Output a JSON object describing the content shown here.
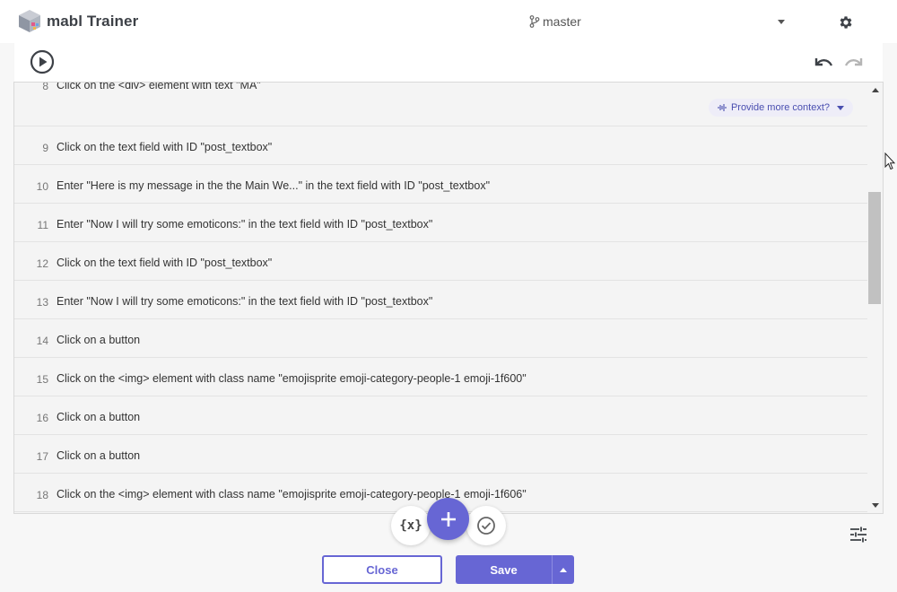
{
  "header": {
    "app_title": "mabl Trainer",
    "branch": "master"
  },
  "steps": [
    {
      "num": "8",
      "text": "Click on the <div> element with text \"MA\"",
      "context_label": "Provide more context?"
    },
    {
      "num": "9",
      "text": "Click on the text field with ID \"post_textbox\""
    },
    {
      "num": "10",
      "text": "Enter \"Here is my message in the the Main We...\" in the text field with ID \"post_textbox\""
    },
    {
      "num": "11",
      "text": "Enter \"Now I will try some emoticons:\" in the text field with ID \"post_textbox\""
    },
    {
      "num": "12",
      "text": "Click on the text field with ID \"post_textbox\""
    },
    {
      "num": "13",
      "text": "Enter \"Now I will try some emoticons:\" in the text field with ID \"post_textbox\""
    },
    {
      "num": "14",
      "text": "Click on a button"
    },
    {
      "num": "15",
      "text": "Click on the <img> element with class name \"emojisprite emoji-category-people-1 emoji-1f600\""
    },
    {
      "num": "16",
      "text": "Click on a button"
    },
    {
      "num": "17",
      "text": "Click on a button"
    },
    {
      "num": "18",
      "text": "Click on the <img> element with class name \"emojisprite emoji-category-people-1 emoji-1f606\""
    }
  ],
  "actions": {
    "variables_label": "{x}",
    "close_label": "Close",
    "save_label": "Save"
  },
  "colors": {
    "accent": "#6766d4",
    "pill_bg": "#eeedf8",
    "pill_text": "#4a4fb0"
  },
  "icons": [
    "logo-icon",
    "branch-icon",
    "chevron-down-icon",
    "gear-icon",
    "play-icon",
    "undo-icon",
    "redo-icon",
    "waveform-icon",
    "plus-icon",
    "check-circle-icon",
    "tune-icon",
    "cursor-icon"
  ]
}
